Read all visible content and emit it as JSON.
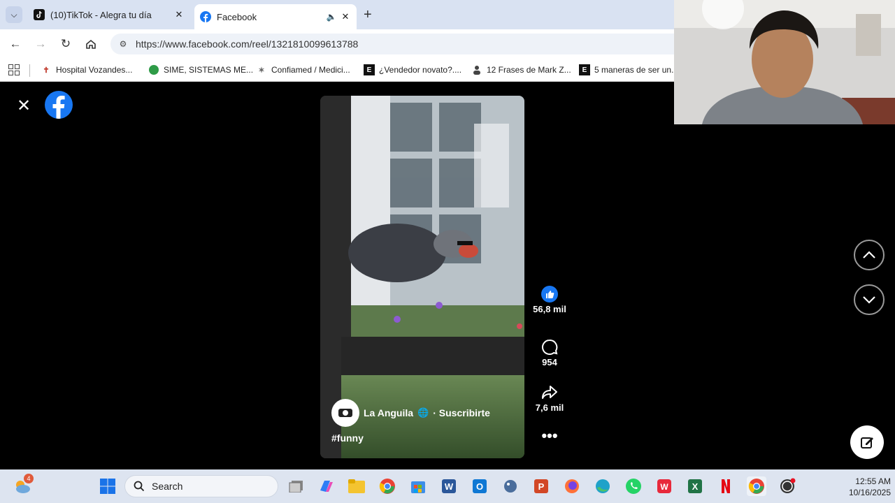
{
  "browser": {
    "tabs": [
      {
        "title": "(10)TikTok - Alegra tu día",
        "icon": "tiktok-icon"
      },
      {
        "title": "Facebook",
        "icon": "facebook-icon"
      }
    ],
    "url": "https://www.facebook.com/reel/1321810099613788",
    "bookmarks": [
      {
        "label": "Hospital Vozandes...",
        "icon": "hospital-icon"
      },
      {
        "label": "SIME, SISTEMAS ME...",
        "icon": "sime-icon"
      },
      {
        "label": "Confiamed / Medici...",
        "icon": "confiamed-icon"
      },
      {
        "label": "¿Vendedor novato?....",
        "icon": "e-icon"
      },
      {
        "label": "12 Frases de Mark Z...",
        "icon": "person-icon"
      },
      {
        "label": "5 maneras de ser un...",
        "icon": "e-icon"
      }
    ]
  },
  "reel": {
    "author": "La Anguila",
    "subscribe": "· Suscribirte",
    "hashtag": "#funny",
    "likes": "56,8 mil",
    "comments": "954",
    "shares": "7,6 mil"
  },
  "taskbar": {
    "search_placeholder": "Search",
    "time": "12:55 AM",
    "date": "10/16/2025",
    "widget_badge": "4"
  },
  "colors": {
    "facebook_blue": "#1877f2",
    "tab_strip": "#d9e2f2",
    "taskbar": "#dde4f0"
  }
}
